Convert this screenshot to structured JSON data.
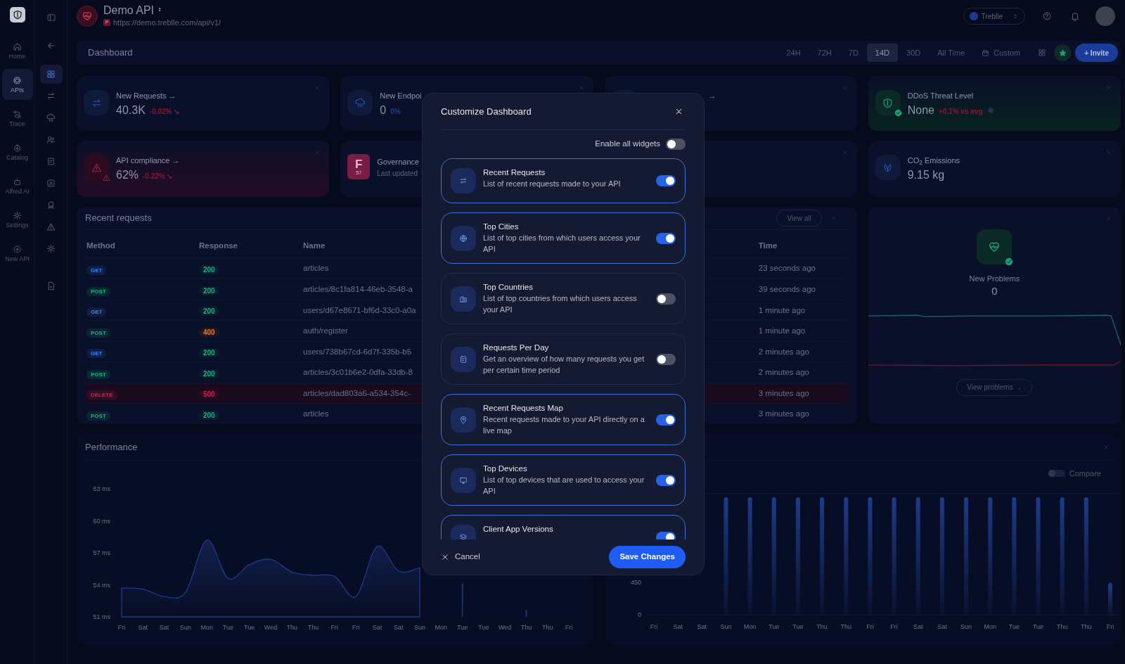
{
  "rail": {
    "items": [
      {
        "label": "Home",
        "selected": false
      },
      {
        "label": "APIs",
        "selected": true
      },
      {
        "label": "Trace",
        "selected": false
      },
      {
        "label": "Catalog",
        "selected": false
      },
      {
        "label": "Alfred AI",
        "selected": false
      },
      {
        "label": "Settings",
        "selected": false
      },
      {
        "label": "New API",
        "selected": false
      }
    ]
  },
  "subnav": {
    "items": [
      {
        "selected": true
      },
      {
        "selected": false
      },
      {
        "selected": false
      },
      {
        "selected": false
      },
      {
        "selected": false
      },
      {
        "selected": false
      },
      {
        "selected": false
      },
      {
        "selected": false
      },
      {
        "selected": false
      },
      {
        "selected": false
      }
    ]
  },
  "header": {
    "title": "Demo API",
    "env_badge": "P",
    "url": "https://demo.treblle.com/api/v1/",
    "org": "Treblle"
  },
  "toolbar": {
    "title": "Dashboard",
    "ranges": [
      {
        "label": "24H",
        "selected": false
      },
      {
        "label": "72H",
        "selected": false
      },
      {
        "label": "7D",
        "selected": false
      },
      {
        "label": "14D",
        "selected": true
      },
      {
        "label": "30D",
        "selected": false
      },
      {
        "label": "All Time",
        "selected": false
      }
    ],
    "custom": "Custom",
    "invite": "+ Invite"
  },
  "cards": [
    {
      "kind": "stat",
      "title": "New Requests →",
      "value": "40.3K",
      "change": {
        "label": "-0.02% ↘",
        "color": "#8f1434"
      }
    },
    {
      "kind": "stat",
      "title": "New Endpoi",
      "value": "0",
      "change": {
        "label": "0%",
        "color": "#1e3a8a"
      }
    },
    {
      "kind": "covered",
      "title": "→"
    },
    {
      "kind": "ok",
      "title": "DDoS Threat Level",
      "value": "None",
      "change": {
        "label": "+0.1% vs avg",
        "color": "#8f1434"
      }
    },
    {
      "kind": "alert",
      "title": "API compliance →",
      "value": "62%",
      "change": {
        "label": "-0.22% ↘",
        "color": "#8f1434"
      }
    },
    {
      "kind": "grade",
      "grade": "F",
      "score": "57",
      "title": "Governance",
      "subtitle": "Last updated"
    },
    {
      "kind": "covered"
    },
    {
      "kind": "stat",
      "title": "CO$_{2}$ Emissions",
      "value": "9.15 kg"
    }
  ],
  "recent_requests": {
    "title": "Recent requests",
    "view_all": "View all",
    "columns": [
      "Method",
      "Response",
      "Name",
      "Time"
    ],
    "rows": [
      {
        "method": {
          "label": "GET",
          "color": "#3b82f6"
        },
        "response": {
          "label": "200",
          "color": "#10b981"
        },
        "name": "articles",
        "time": "23 seconds ago",
        "error": false
      },
      {
        "method": {
          "label": "POST",
          "color": "#10b981"
        },
        "response": {
          "label": "200",
          "color": "#10b981"
        },
        "name": "articles/8c1fa814-46eb-3548-a",
        "time": "39 seconds ago",
        "error": false
      },
      {
        "method": {
          "label": "GET",
          "color": "#3b82f6"
        },
        "response": {
          "label": "200",
          "color": "#10b981"
        },
        "name": "users/d67e8671-bf6d-33c0-a0a",
        "time": "1 minute ago",
        "error": false
      },
      {
        "method": {
          "label": "POST",
          "color": "#10b981"
        },
        "response": {
          "label": "400",
          "color": "#f97316"
        },
        "name": "auth/register",
        "time": "1 minute ago",
        "error": false
      },
      {
        "method": {
          "label": "GET",
          "color": "#3b82f6"
        },
        "response": {
          "label": "200",
          "color": "#10b981"
        },
        "name": "users/738b67cd-6d7f-335b-b5",
        "time": "2 minutes ago",
        "error": false
      },
      {
        "method": {
          "label": "POST",
          "color": "#10b981"
        },
        "response": {
          "label": "200",
          "color": "#10b981"
        },
        "name": "articles/3c01b6e2-0dfa-33db-8",
        "time": "2 minutes ago",
        "error": false
      },
      {
        "method": {
          "label": "DELETE",
          "color": "#e11d48"
        },
        "response": {
          "label": "500",
          "color": "#e11d48"
        },
        "name": "articles/dad803a6-a534-354c-",
        "time": "3 minutes ago",
        "error": true
      },
      {
        "method": {
          "label": "POST",
          "color": "#10b981"
        },
        "response": {
          "label": "200",
          "color": "#10b981"
        },
        "name": "articles",
        "time": "3 minutes ago",
        "error": false
      }
    ]
  },
  "problems": {
    "title": "New Problems",
    "value": "0",
    "button": "View problems →"
  },
  "performance": {
    "title": "Performance",
    "chart_data": {
      "type": "area",
      "categories": [
        "Fri",
        "Sat",
        "Sat",
        "Sun",
        "Mon",
        "Tue",
        "Tue",
        "Wed",
        "Thu",
        "Thu",
        "Fri",
        "Fri",
        "Sat",
        "Sat",
        "Sun",
        "Mon",
        "Tue",
        "Tue",
        "Wed",
        "Thu",
        "Thu",
        "Fri"
      ],
      "series": [
        {
          "color": "#1e3a8a",
          "values": [
            53.7,
            53.6,
            52.9,
            53.3,
            58.2,
            54.6,
            55.9,
            56.4,
            55.2,
            54.9,
            54.8,
            52.9,
            57.6,
            55.3,
            55.6,
            null,
            54.1,
            null,
            null,
            51.6,
            null,
            null
          ]
        }
      ],
      "ylim": [
        51,
        63
      ],
      "yticks": [
        {
          "value": 51,
          "label": "51 ms"
        },
        {
          "value": 54,
          "label": "54 ms"
        },
        {
          "value": 57,
          "label": "57 ms"
        },
        {
          "value": 60,
          "label": "60 ms"
        },
        {
          "value": 63,
          "label": "63 ms"
        }
      ]
    }
  },
  "requests_chart": {
    "compare_label": "Compare",
    "compare": false,
    "chart_data": {
      "type": "bar",
      "categories": [
        "Fri",
        "Sat",
        "Sat",
        "Sun",
        "Mon",
        "Tue",
        "Tue",
        "Thu",
        "Thu",
        "Fri",
        "Fri",
        "Sat",
        "Sat",
        "Sun",
        "Mon",
        "Tue",
        "Tue",
        "Thu",
        "Thu",
        "Fri"
      ],
      "series": [
        {
          "color": "#1e3a8a",
          "values": [
            null,
            null,
            null,
            1650,
            1650,
            1650,
            1650,
            1650,
            1650,
            1650,
            1650,
            1650,
            1650,
            1650,
            1650,
            1650,
            1650,
            1650,
            1650,
            450
          ]
        }
      ],
      "ylim": [
        0,
        1700
      ],
      "yticks": [
        0,
        450
      ]
    }
  },
  "modal": {
    "title": "Customize Dashboard",
    "enable_all_label": "Enable all widgets",
    "enable_all": false,
    "widgets": [
      {
        "title": "Recent Requests",
        "description": "List of recent requests made to your API",
        "on": true
      },
      {
        "title": "Top Cities",
        "description": "List of top cities from which users access your API",
        "on": true
      },
      {
        "title": "Top Countries",
        "description": "List of top countries from which users access your API",
        "on": false
      },
      {
        "title": "Requests Per Day",
        "description": "Get an overview of how many requests you get per certain time period",
        "on": false
      },
      {
        "title": "Recent Requests Map",
        "description": "Recent requests made to your API directly on a live map",
        "on": true
      },
      {
        "title": "Top Devices",
        "description": "List of top devices that are used to access your API",
        "on": true
      },
      {
        "title": "Client App Versions",
        "on": true
      }
    ],
    "cancel": "Cancel",
    "save": "Save Changes"
  }
}
